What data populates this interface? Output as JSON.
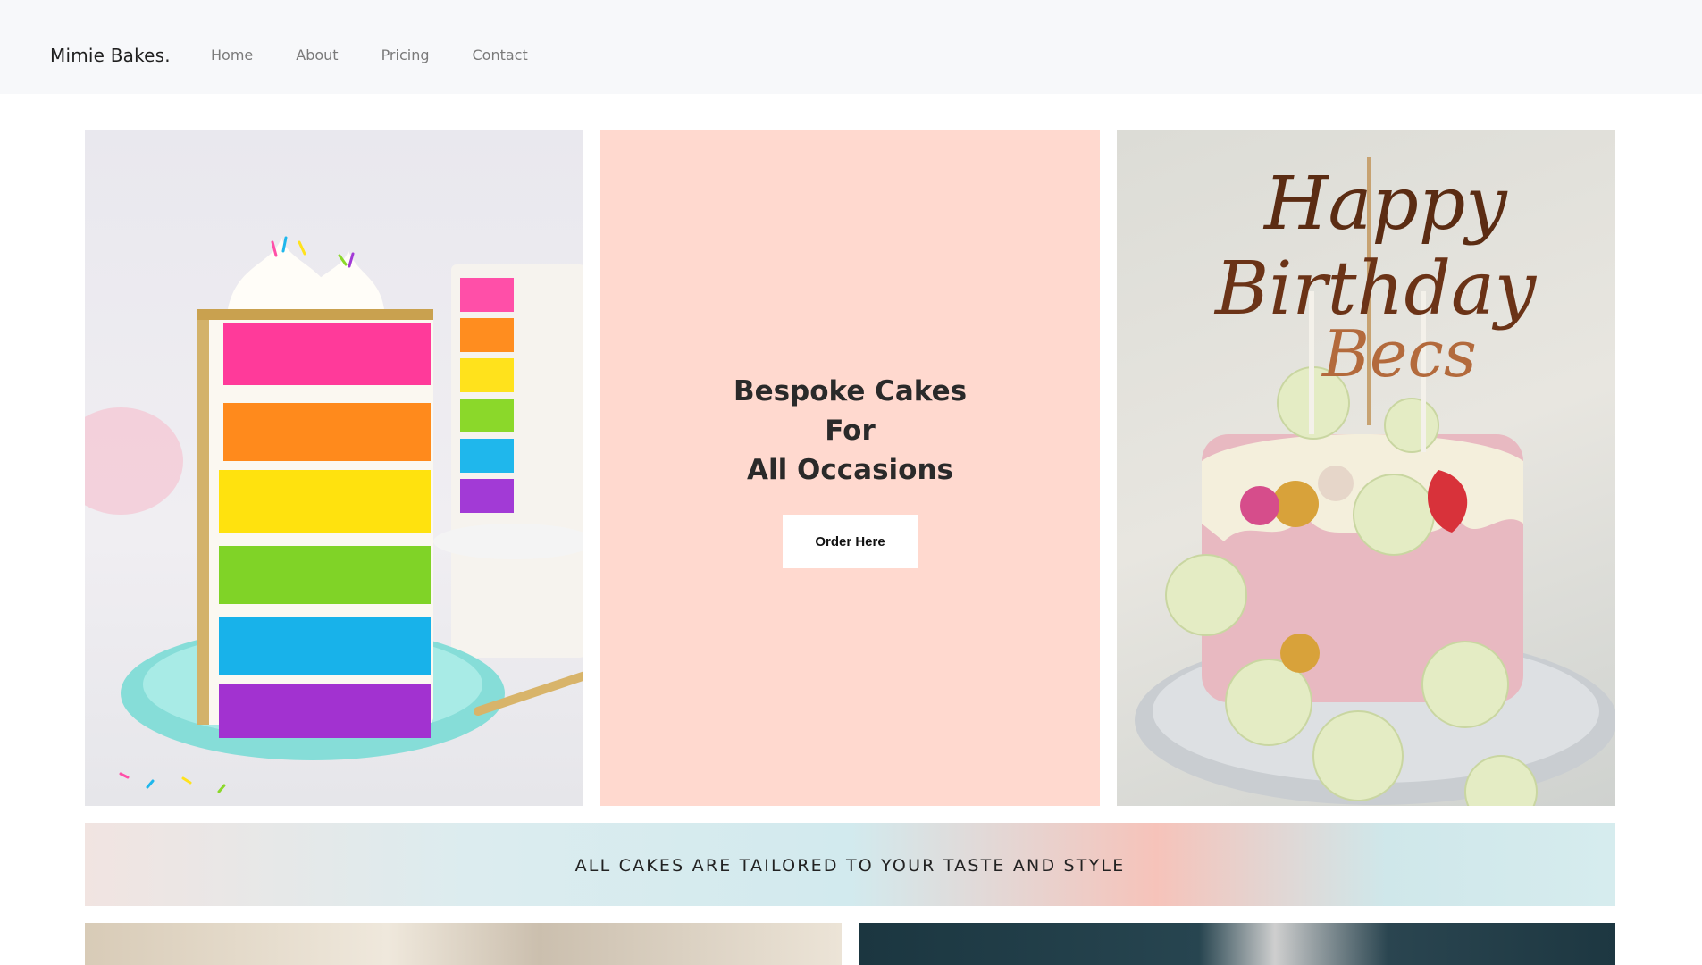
{
  "navbar": {
    "brand": "Mimie Bakes.",
    "links": [
      {
        "label": "Home"
      },
      {
        "label": "About"
      },
      {
        "label": "Pricing"
      },
      {
        "label": "Contact"
      }
    ]
  },
  "hero": {
    "headline_lines": [
      "Bespoke Cakes",
      "For",
      "All Occasions"
    ],
    "order_button": "Order Here",
    "panel_color": "#ffd9cf",
    "left_image": "rainbow-layer-cake-slice-image",
    "right_image": "happy-birthday-cake-image",
    "topper_text": [
      "Happy",
      "Birthday",
      "Becs"
    ]
  },
  "banner": {
    "text": "ALL CAKES ARE TAILORED TO YOUR TASTE AND STYLE"
  }
}
